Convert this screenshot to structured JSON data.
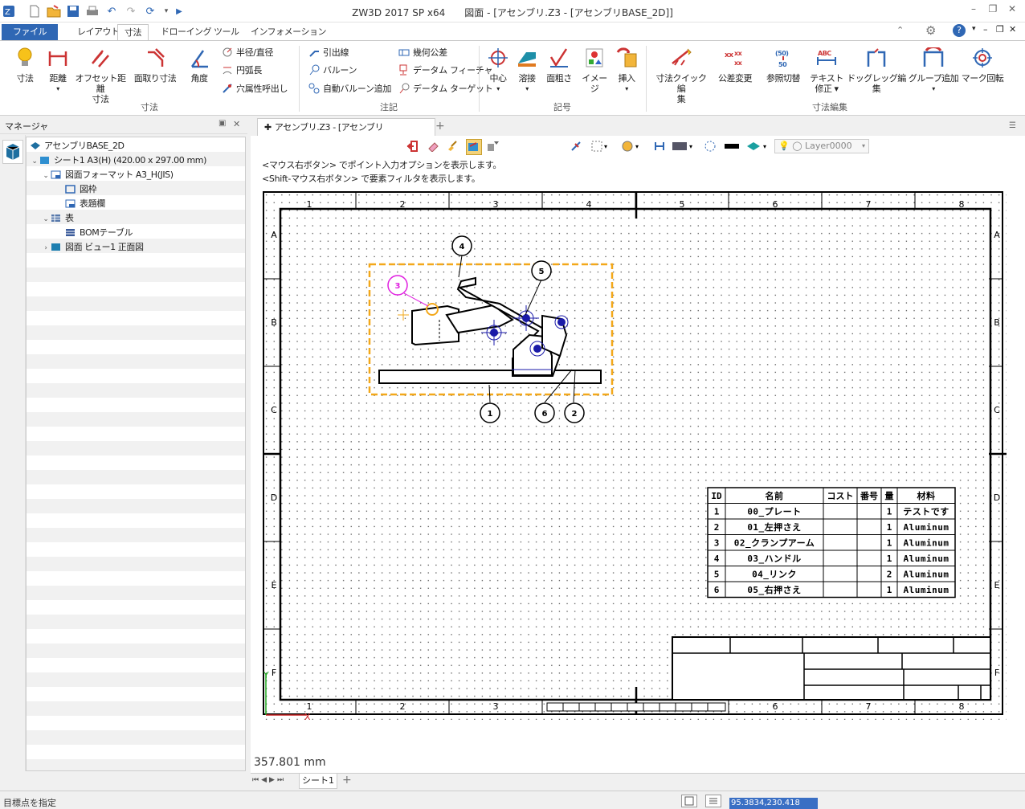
{
  "app": {
    "title": "ZW3D 2017 SP x64　　図面 - [アセンブリ.Z3 - [アセンブリBASE_2D]]"
  },
  "tabs": [
    "ファイル(F)",
    "レイアウト",
    "寸法",
    "ドローイング",
    "ツール",
    "インフォメーション"
  ],
  "ribbon": {
    "dimension": {
      "dim": "寸法",
      "distance": "距離",
      "offset1": "オフセット距離",
      "offset2": "寸法",
      "chamfer": "面取り寸法",
      "angle": "角度",
      "radius": "半径/直径",
      "arc": "円弧長",
      "hole": "穴属性呼出し",
      "group": "寸法"
    },
    "annotation": {
      "leader": "引出線",
      "balloon": "バルーン",
      "auto_balloon": "自動バルーン追加",
      "geo_tol": "幾何公差",
      "datum_feature": "データム フィーチャ",
      "datum_target": "データム ターゲット",
      "group": "注記"
    },
    "symbol": {
      "center": "中心",
      "weld": "溶接",
      "roughness": "面粗さ",
      "image": "イメージ",
      "insert": "挿入",
      "group": "記号"
    },
    "dimedit": {
      "quick1": "寸法クイック編",
      "quick2": "集",
      "tolerance": "公差変更",
      "ref": "参照切替",
      "text1": "テキスト",
      "text2": "修正",
      "drag": "ドッグレッグ編集",
      "groupadd": "グループ追加",
      "mark": "マーク回転",
      "group": "寸法編集"
    }
  },
  "manager": {
    "title": "マネージャ",
    "tree": [
      "アセンブリBASE_2D",
      "シート1 A3(H) (420.00 x 297.00 mm)",
      "図面フォーマット A3_H(JIS)",
      "図枠",
      "表題欄",
      "表",
      "BOMテーブル",
      "図面 ビュー1 正面図"
    ]
  },
  "document": {
    "tab": "アセンブリ.Z3 - [アセンブリBASE_2D]",
    "hint1": "<マウス右ボタン> でポイント入力オプションを表示します。",
    "hint2": "<Shift-マウス右ボタン> で要素フィルタを表示します。",
    "layer": "Layer0000",
    "measure": "357.801 mm"
  },
  "drawing": {
    "col_labels": [
      "1",
      "2",
      "3",
      "4",
      "5",
      "6",
      "7",
      "8"
    ],
    "row_labels": [
      "A",
      "B",
      "C",
      "D",
      "E",
      "F"
    ],
    "balloons": [
      "1",
      "2",
      "3",
      "4",
      "5",
      "6"
    ],
    "bom": {
      "headers": [
        "ID",
        "名前",
        "コスト",
        "番号",
        "量",
        "材料"
      ],
      "rows": [
        [
          "1",
          "00_プレート",
          "",
          "",
          "1",
          "テストです"
        ],
        [
          "2",
          "01_左押さえ",
          "",
          "",
          "1",
          "Aluminum"
        ],
        [
          "3",
          "02_クランプアーム",
          "",
          "",
          "1",
          "Aluminum"
        ],
        [
          "4",
          "03_ハンドル",
          "",
          "",
          "1",
          "Aluminum"
        ],
        [
          "5",
          "04_リンク",
          "",
          "",
          "2",
          "Aluminum"
        ],
        [
          "6",
          "05_右押さえ",
          "",
          "",
          "1",
          "Aluminum"
        ]
      ]
    },
    "axis_x": "X",
    "axis_y": "Y"
  },
  "sheet_tabs": [
    "シート1"
  ],
  "status": {
    "prompt": "目標点を指定",
    "coords": "95.3834,230.418"
  },
  "colors": {
    "accent": "#2f67b4",
    "selection": "#f3a81a",
    "highlight": "#e020e0",
    "constraint": "#1a1aa8"
  }
}
